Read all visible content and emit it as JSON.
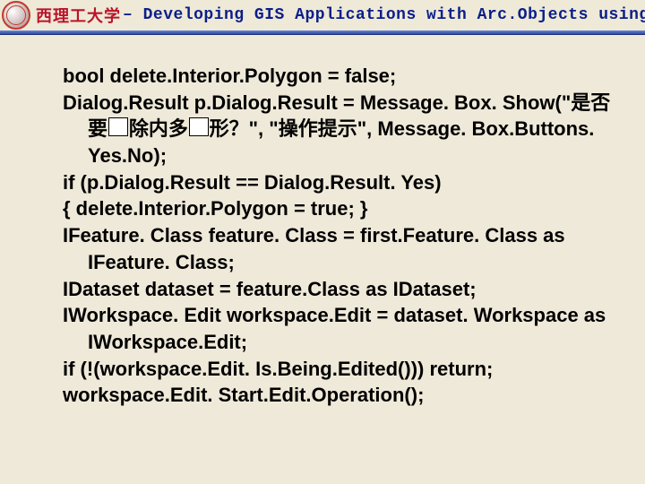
{
  "header": {
    "university": "西理工大学",
    "separator": " – ",
    "course_title": "Developing GIS Applications with Arc.Objects using C#. NE"
  },
  "code": {
    "lines": [
      "bool delete.Interior.Polygon = false;",
      "Dialog.Result p.Dialog.Result = Message. Box. Show(\"是否要□除内多□形？\", \"操作提示\", Message. Box.Buttons. Yes.No);",
      "if (p.Dialog.Result == Dialog.Result. Yes)",
      " {    delete.Interior.Polygon = true;      }",
      "IFeature. Class feature. Class = first.Feature. Class as IFeature. Class;",
      "IDataset dataset = feature.Class as IDataset;",
      "IWorkspace. Edit workspace.Edit = dataset. Workspace as IWorkspace.Edit;",
      "if (!(workspace.Edit. Is.Being.Edited())) return;",
      "workspace.Edit. Start.Edit.Operation();"
    ]
  }
}
